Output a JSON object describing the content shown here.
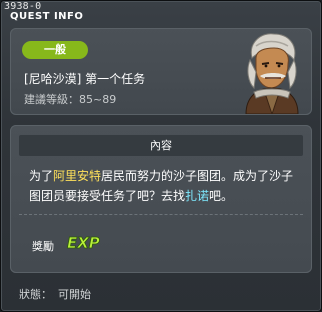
{
  "window": {
    "quest_id": "3938-0",
    "title": "QUEST INFO"
  },
  "quest": {
    "grade": "一般",
    "name": "[尼哈沙漠] 第一个任务",
    "level_label": "建議等級：",
    "level_range": "85~89"
  },
  "content": {
    "header": "內容",
    "text_1": "为了",
    "highlight_place": "阿里安特",
    "text_2": "居民而努力的沙子图团。成为了沙子图团员要接受任务了吧？去找",
    "highlight_npc": "扎诺",
    "text_3": "吧。"
  },
  "reward": {
    "label": "獎勵",
    "exp_text": "EXP"
  },
  "status": {
    "label": "狀態：",
    "value": "可開始"
  },
  "colors": {
    "badge": "#87b81b",
    "highlight_yellow": "#ffe15a",
    "highlight_cyan": "#7feaff",
    "exp_green": "#b9f03a"
  },
  "icons": {
    "npc_portrait": "npc-portrait-icon",
    "exp": "exp-reward-icon"
  }
}
